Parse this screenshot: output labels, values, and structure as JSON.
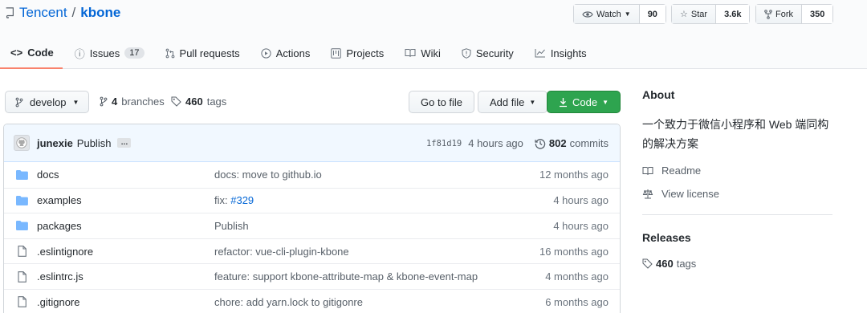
{
  "repo": {
    "owner": "Tencent",
    "separator": "/",
    "name": "kbone"
  },
  "actions": [
    {
      "icon": "eye-icon",
      "label": "Watch",
      "count": "90"
    },
    {
      "icon": "star-icon",
      "label": "Star",
      "count": "3.6k"
    },
    {
      "icon": "fork-icon",
      "label": "Fork",
      "count": "350"
    }
  ],
  "tabs": [
    {
      "icon": "code-icon",
      "label": "Code",
      "counter": ""
    },
    {
      "icon": "issue-icon",
      "label": "Issues",
      "counter": "17"
    },
    {
      "icon": "pull-request-icon",
      "label": "Pull requests",
      "counter": ""
    },
    {
      "icon": "play-icon",
      "label": "Actions",
      "counter": ""
    },
    {
      "icon": "project-icon",
      "label": "Projects",
      "counter": ""
    },
    {
      "icon": "book-icon",
      "label": "Wiki",
      "counter": ""
    },
    {
      "icon": "shield-icon",
      "label": "Security",
      "counter": ""
    },
    {
      "icon": "graph-icon",
      "label": "Insights",
      "counter": ""
    }
  ],
  "toolbar": {
    "branch": "develop",
    "branches_count": "4",
    "branches_label": "branches",
    "tags_count": "460",
    "tags_label": "tags",
    "go_to_file": "Go to file",
    "add_file": "Add file",
    "code": "Code"
  },
  "commit": {
    "author": "junexie",
    "message": "Publish",
    "ellipsis": "…",
    "sha": "1f81d19",
    "time": "4 hours ago",
    "commits_count": "802",
    "commits_label": "commits"
  },
  "files": [
    {
      "type": "folder",
      "name": "docs",
      "message": "docs: move to github.io",
      "link": "",
      "age": "12 months ago"
    },
    {
      "type": "folder",
      "name": "examples",
      "message": "fix: ",
      "link": "#329",
      "age": "4 hours ago"
    },
    {
      "type": "folder",
      "name": "packages",
      "message": "Publish",
      "link": "",
      "age": "4 hours ago"
    },
    {
      "type": "file",
      "name": ".eslintignore",
      "message": "refactor: vue-cli-plugin-kbone",
      "link": "",
      "age": "16 months ago"
    },
    {
      "type": "file",
      "name": ".eslintrc.js",
      "message": "feature: support kbone-attribute-map & kbone-event-map",
      "link": "",
      "age": "4 months ago"
    },
    {
      "type": "file",
      "name": ".gitignore",
      "message": "chore: add yarn.lock to gitigonre",
      "link": "",
      "age": "6 months ago"
    }
  ],
  "sidebar": {
    "about_heading": "About",
    "description": "一个致力于微信小程序和 Web 端同构的解决方案",
    "readme": "Readme",
    "license": "View license",
    "releases_heading": "Releases",
    "tags_count": "460",
    "tags_label": "tags"
  },
  "colors": {
    "accent": "#0366d6",
    "green": "#2ea44f",
    "tab_underline": "#f9826c",
    "folder": "#79b8ff"
  }
}
